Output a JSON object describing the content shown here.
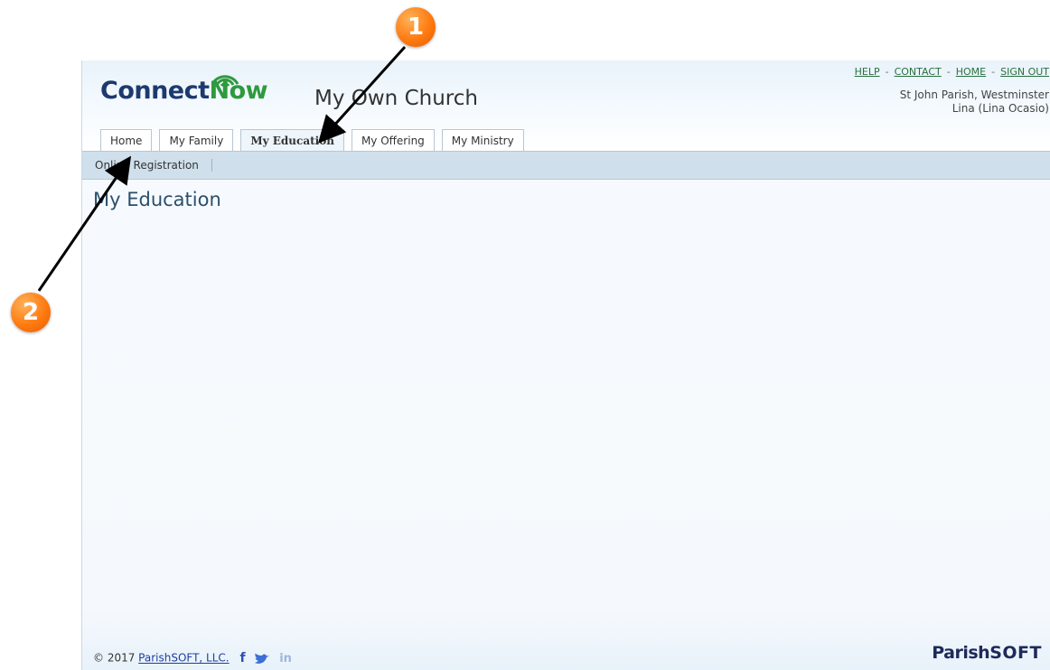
{
  "header": {
    "logo_connect": "Connect",
    "logo_now": "Now",
    "church_title": "My Own Church",
    "top_links": [
      "HELP",
      "CONTACT",
      "HOME",
      "SIGN OUT"
    ],
    "top_link_separator": "-",
    "parish": "St John Parish, Westminster",
    "user": "Lina (Lina Ocasio)"
  },
  "tabs": [
    {
      "label": "Home"
    },
    {
      "label": "My Family"
    },
    {
      "label": "My Education",
      "active": true
    },
    {
      "label": "My Offering"
    },
    {
      "label": "My Ministry"
    }
  ],
  "subnav": {
    "items": [
      "Online Registration"
    ]
  },
  "main": {
    "heading": "My Education"
  },
  "footer": {
    "copyright_prefix": "© 2017 ",
    "company_link": "ParishSOFT, LLC.",
    "social_icons": [
      "facebook-icon",
      "twitter-icon",
      "linkedin-icon"
    ],
    "fb_glyph": "f",
    "li_glyph": "in",
    "brand_parish": "Parish",
    "brand_soft": "SOFT"
  },
  "annotations": {
    "callout_1": "1",
    "callout_2": "2"
  },
  "colors": {
    "callout": "#ff7a10",
    "link": "#2a6f3f",
    "subnav_bg": "#cfe0ec",
    "heading": "#2b4f6b"
  }
}
